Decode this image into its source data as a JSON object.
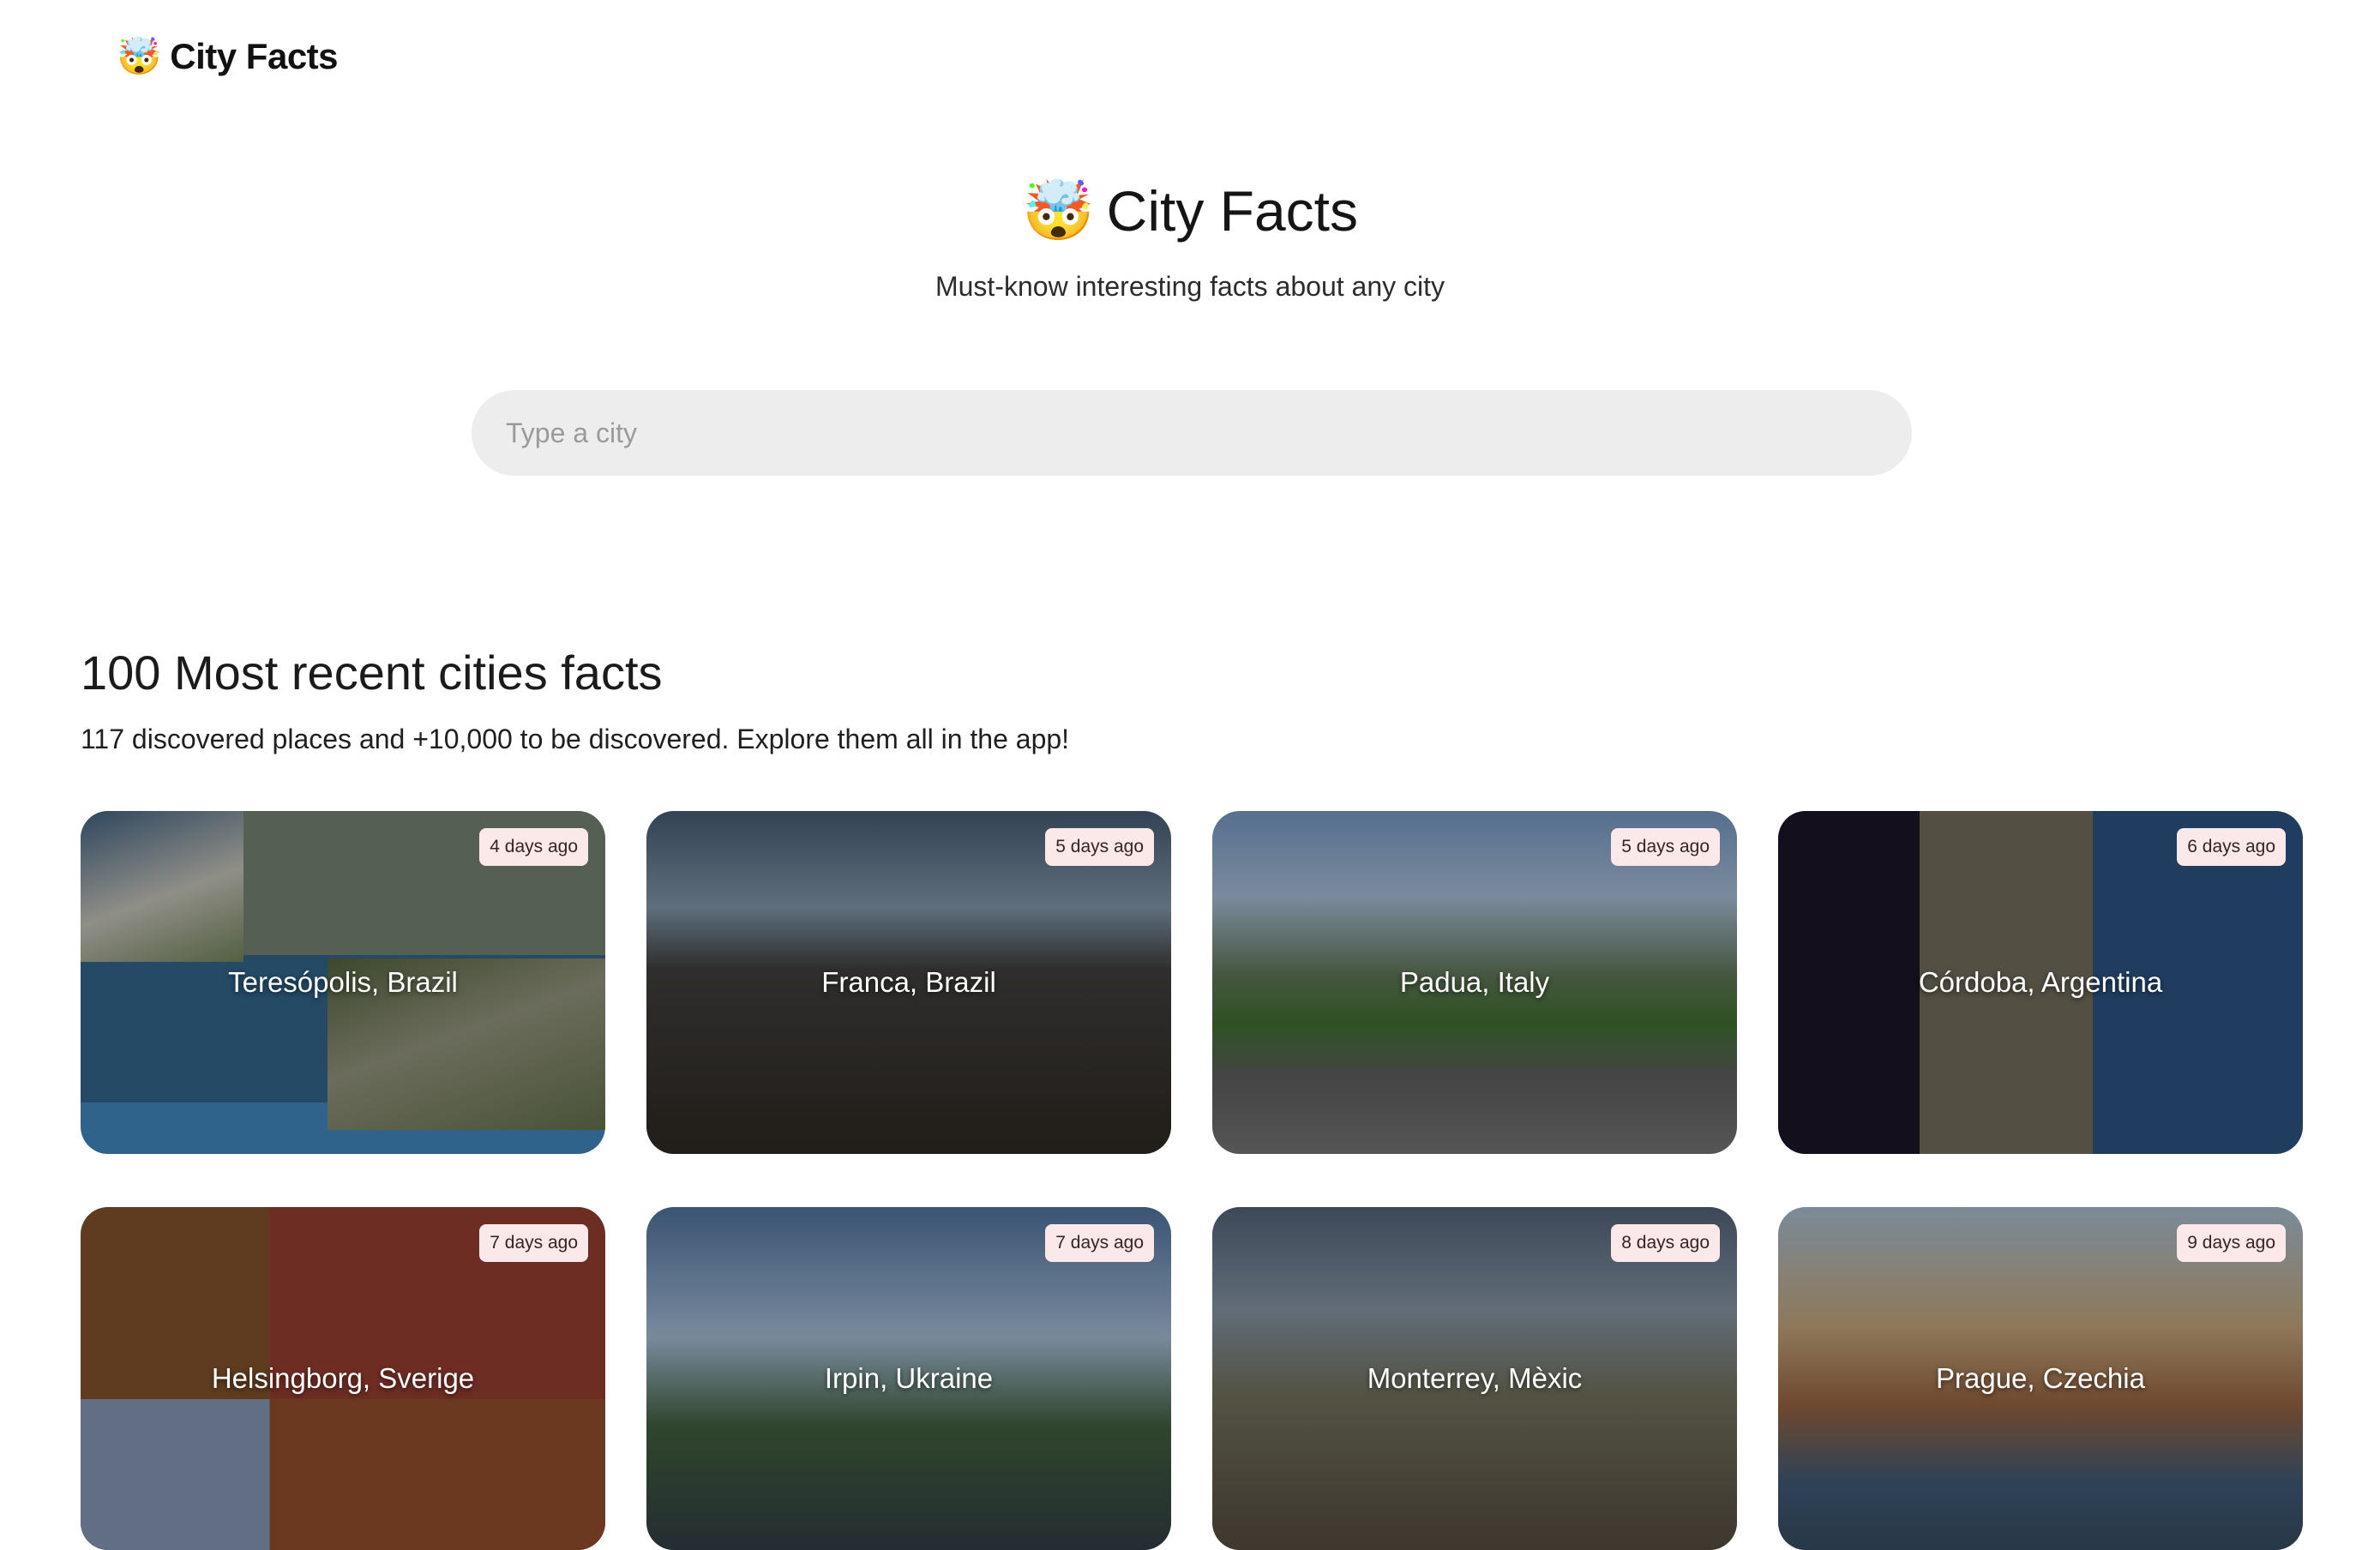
{
  "nav": {
    "logo_emoji": "🤯",
    "title": "City Facts"
  },
  "hero": {
    "emoji": "🤯",
    "title": "City Facts",
    "subtitle": "Must-know interesting facts about any city"
  },
  "search": {
    "placeholder": "Type a city",
    "value": ""
  },
  "section": {
    "title": "100 Most recent cities facts",
    "subtitle": "117 discovered places and +10,000 to be discovered. Explore them all in the app!"
  },
  "cards": [
    {
      "name": "Teresópolis, Brazil",
      "age": "4 days ago"
    },
    {
      "name": "Franca, Brazil",
      "age": "5 days ago"
    },
    {
      "name": "Padua, Italy",
      "age": "5 days ago"
    },
    {
      "name": "Córdoba, Argentina",
      "age": "6 days ago"
    },
    {
      "name": "Helsingborg, Sverige",
      "age": "7 days ago"
    },
    {
      "name": "Irpin, Ukraine",
      "age": "7 days ago"
    },
    {
      "name": "Monterrey, Mèxic",
      "age": "8 days ago"
    },
    {
      "name": "Prague, Czechia",
      "age": "9 days ago"
    }
  ]
}
